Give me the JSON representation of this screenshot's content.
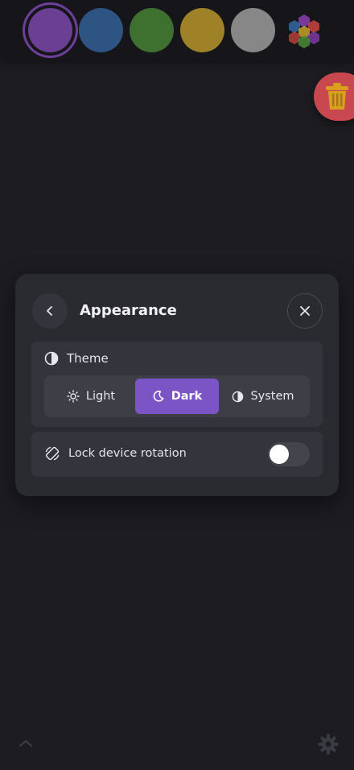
{
  "palette": {
    "swatches": [
      {
        "name": "purple",
        "color": "#6a3f94",
        "selected": true
      },
      {
        "name": "blue",
        "color": "#3567a2",
        "selected": false
      },
      {
        "name": "green",
        "color": "#4a8a37",
        "selected": false
      },
      {
        "name": "yellow",
        "color": "#c6a12d",
        "selected": false
      },
      {
        "name": "gray",
        "color": "#a8a8a8",
        "selected": false
      }
    ],
    "multicolor_icon": "hexagon-cluster-icon"
  },
  "trash": {
    "icon": "trash-icon",
    "color": "#c9484f"
  },
  "dialog": {
    "title": "Appearance",
    "back_icon": "chevron-left-icon",
    "close_icon": "close-icon",
    "theme": {
      "label": "Theme",
      "icon": "half-circle-icon",
      "options": [
        {
          "label": "Light",
          "icon": "sun-icon",
          "selected": false
        },
        {
          "label": "Dark",
          "icon": "moon-icon",
          "selected": true
        },
        {
          "label": "System",
          "icon": "half-circle-icon",
          "selected": false
        }
      ],
      "accent": "#7b54c5"
    },
    "lock_rotation": {
      "label": "Lock device rotation",
      "icon": "rotate-device-icon",
      "enabled": false
    }
  },
  "footer": {
    "left_icon": "chevron-up-icon",
    "right_icon": "gear-icon"
  }
}
